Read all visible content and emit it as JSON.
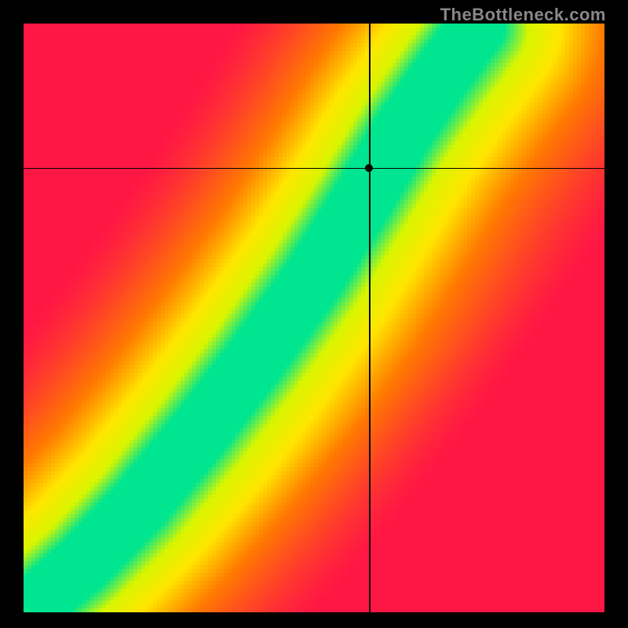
{
  "watermark": "TheBottleneck.com",
  "chart_data": {
    "type": "heatmap",
    "title": "",
    "xlabel": "",
    "ylabel": "",
    "xlim": [
      0,
      1
    ],
    "ylim": [
      0,
      1
    ],
    "crosshair": {
      "x": 0.595,
      "y": 0.755
    },
    "marker": {
      "x": 0.595,
      "y": 0.755
    },
    "color_scale": [
      {
        "value": 0.0,
        "color": "#ff1744"
      },
      {
        "value": 0.4,
        "color": "#ff7b00"
      },
      {
        "value": 0.65,
        "color": "#ffe500"
      },
      {
        "value": 0.85,
        "color": "#d8f500"
      },
      {
        "value": 1.0,
        "color": "#00e58f"
      }
    ],
    "optimal_ridge": {
      "description": "Curved center path from lower-left corner to upper-right region where compatibility is highest",
      "points_xy": [
        [
          0.0,
          0.0
        ],
        [
          0.1,
          0.08
        ],
        [
          0.2,
          0.18
        ],
        [
          0.3,
          0.3
        ],
        [
          0.4,
          0.43
        ],
        [
          0.5,
          0.57
        ],
        [
          0.58,
          0.7
        ],
        [
          0.65,
          0.82
        ],
        [
          0.72,
          0.92
        ],
        [
          0.78,
          1.0
        ]
      ],
      "half_width_normalized": 0.06
    },
    "resolution_hint": "coarse-pixelated"
  }
}
